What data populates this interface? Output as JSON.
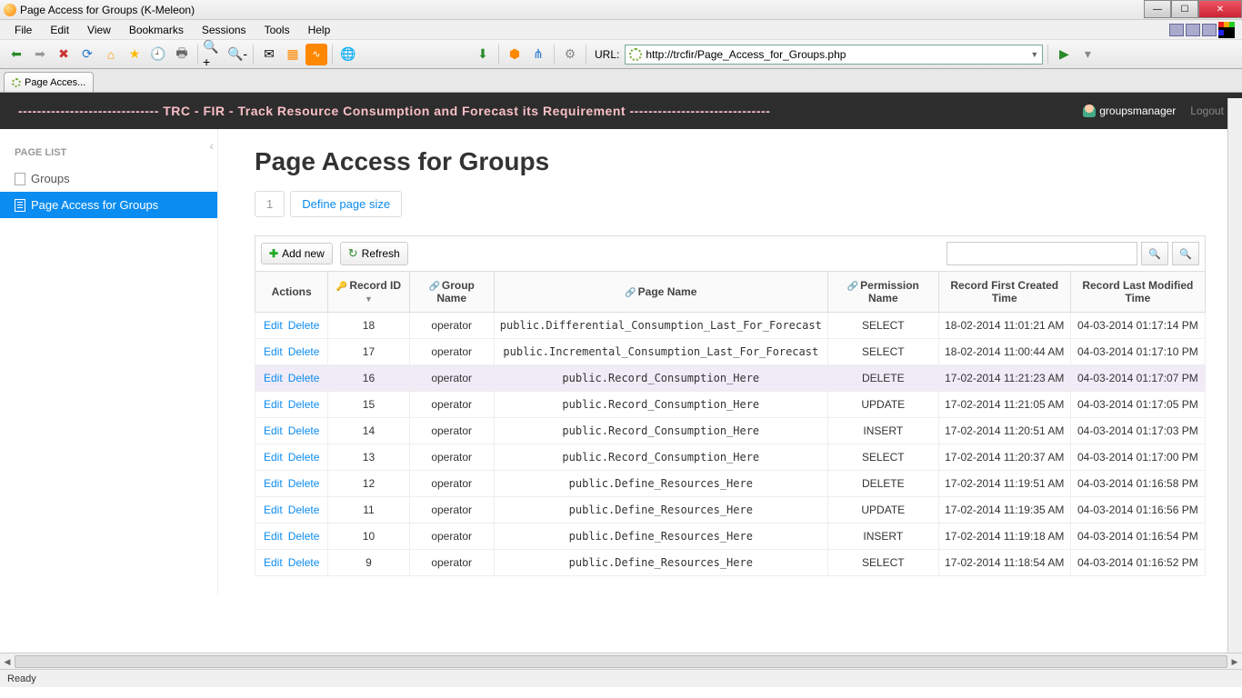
{
  "window": {
    "title": "Page Access for Groups (K-Meleon)"
  },
  "menubar": [
    "File",
    "Edit",
    "View",
    "Bookmarks",
    "Sessions",
    "Tools",
    "Help"
  ],
  "url": {
    "label": "URL:",
    "value": "http://trcfir/Page_Access_for_Groups.php"
  },
  "browser_tab": "Page Acces...",
  "app": {
    "title": "------------------------------ TRC - FIR - Track Resource Consumption and Forecast its Requirement ------------------------------",
    "user": "groupsmanager",
    "logout": "Logout"
  },
  "sidebar": {
    "title": "PAGE LIST",
    "items": [
      {
        "label": "Groups",
        "active": false
      },
      {
        "label": "Page Access for Groups",
        "active": true
      }
    ]
  },
  "main": {
    "title": "Page Access for Groups",
    "pager": {
      "current": "1",
      "define": "Define page size"
    },
    "toolbar": {
      "add": "Add new",
      "refresh": "Refresh"
    },
    "columns": [
      "Actions",
      "Record ID",
      "Group Name",
      "Page Name",
      "Permission Name",
      "Record First Created Time",
      "Record Last Modified Time"
    ],
    "action_labels": {
      "edit": "Edit",
      "delete": "Delete"
    },
    "rows": [
      {
        "id": "18",
        "group": "operator",
        "page": "public.Differential_Consumption_Last_For_Forecast",
        "perm": "SELECT",
        "created": "18-02-2014 11:01:21 AM",
        "modified": "04-03-2014 01:17:14 PM"
      },
      {
        "id": "17",
        "group": "operator",
        "page": "public.Incremental_Consumption_Last_For_Forecast",
        "perm": "SELECT",
        "created": "18-02-2014 11:00:44 AM",
        "modified": "04-03-2014 01:17:10 PM"
      },
      {
        "id": "16",
        "group": "operator",
        "page": "public.Record_Consumption_Here",
        "perm": "DELETE",
        "created": "17-02-2014 11:21:23 AM",
        "modified": "04-03-2014 01:17:07 PM",
        "highlight": true
      },
      {
        "id": "15",
        "group": "operator",
        "page": "public.Record_Consumption_Here",
        "perm": "UPDATE",
        "created": "17-02-2014 11:21:05 AM",
        "modified": "04-03-2014 01:17:05 PM"
      },
      {
        "id": "14",
        "group": "operator",
        "page": "public.Record_Consumption_Here",
        "perm": "INSERT",
        "created": "17-02-2014 11:20:51 AM",
        "modified": "04-03-2014 01:17:03 PM"
      },
      {
        "id": "13",
        "group": "operator",
        "page": "public.Record_Consumption_Here",
        "perm": "SELECT",
        "created": "17-02-2014 11:20:37 AM",
        "modified": "04-03-2014 01:17:00 PM"
      },
      {
        "id": "12",
        "group": "operator",
        "page": "public.Define_Resources_Here",
        "perm": "DELETE",
        "created": "17-02-2014 11:19:51 AM",
        "modified": "04-03-2014 01:16:58 PM"
      },
      {
        "id": "11",
        "group": "operator",
        "page": "public.Define_Resources_Here",
        "perm": "UPDATE",
        "created": "17-02-2014 11:19:35 AM",
        "modified": "04-03-2014 01:16:56 PM"
      },
      {
        "id": "10",
        "group": "operator",
        "page": "public.Define_Resources_Here",
        "perm": "INSERT",
        "created": "17-02-2014 11:19:18 AM",
        "modified": "04-03-2014 01:16:54 PM"
      },
      {
        "id": "9",
        "group": "operator",
        "page": "public.Define_Resources_Here",
        "perm": "SELECT",
        "created": "17-02-2014 11:18:54 AM",
        "modified": "04-03-2014 01:16:52 PM"
      }
    ]
  },
  "statusbar": "Ready"
}
